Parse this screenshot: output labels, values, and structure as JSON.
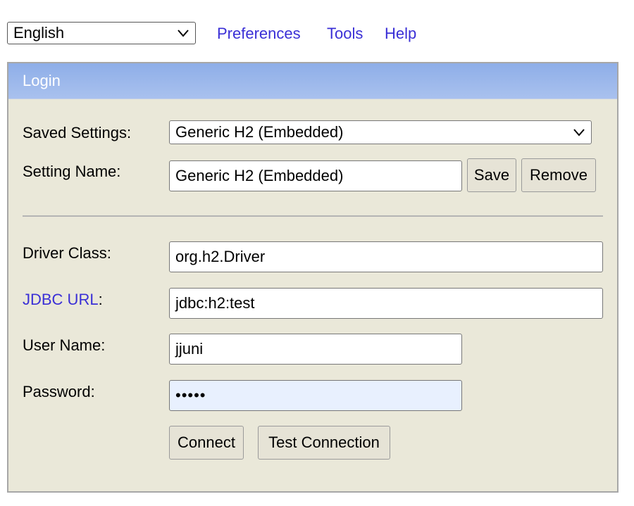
{
  "topbar": {
    "language": "English",
    "links": [
      "Preferences",
      "Tools",
      "Help"
    ]
  },
  "login": {
    "title": "Login",
    "saved_settings_label": "Saved Settings:",
    "saved_settings_value": "Generic H2 (Embedded)",
    "setting_name_label": "Setting Name:",
    "setting_name_value": "Generic H2 (Embedded)",
    "save_label": "Save",
    "remove_label": "Remove",
    "driver_class_label": "Driver Class:",
    "driver_class_value": "org.h2.Driver",
    "jdbc_url_label": "JDBC URL",
    "jdbc_url_colon": ":",
    "jdbc_url_value": "jdbc:h2:test",
    "user_name_label": "User Name:",
    "user_name_value": "jjuni",
    "password_label": "Password:",
    "password_mask": "•••••",
    "connect_label": "Connect",
    "test_connection_label": "Test Connection"
  },
  "colors": {
    "link": "#3a2fd6",
    "panel_bg": "#eae8d9",
    "header_bg": "#8eaee8",
    "password_bg": "#e8f0fe"
  }
}
